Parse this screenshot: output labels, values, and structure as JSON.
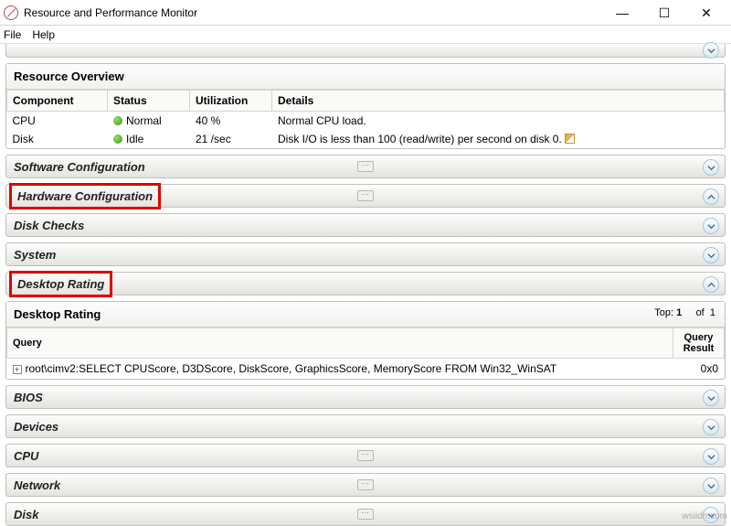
{
  "window": {
    "title": "Resource and Performance Monitor"
  },
  "menu": {
    "file": "File",
    "help": "Help"
  },
  "overview": {
    "title": "Resource Overview",
    "cols": {
      "component": "Component",
      "status": "Status",
      "util": "Utilization",
      "details": "Details"
    },
    "rows": [
      {
        "component": "CPU",
        "status": "Normal",
        "util": "40 %",
        "details": "Normal CPU load."
      },
      {
        "component": "Disk",
        "status": "Idle",
        "util": "21 /sec",
        "details": "Disk I/O is less than 100 (read/write) per second on disk 0.",
        "editable": true
      }
    ]
  },
  "sections": {
    "software": "Software Configuration",
    "hardware": "Hardware Configuration",
    "diskchecks": "Disk Checks",
    "system": "System",
    "desktoprating": "Desktop Rating",
    "bios": "BIOS",
    "devices": "Devices",
    "cpu": "CPU",
    "network": "Network",
    "disk": "Disk"
  },
  "desktop_rating": {
    "title": "Desktop Rating",
    "top_label": "Top:",
    "top_value": "1",
    "of_label": "of",
    "of_value": "1",
    "query_col": "Query",
    "result_col": "Query Result",
    "row": {
      "query": "root\\cimv2:SELECT CPUScore, D3DScore, DiskScore, GraphicsScore, MemoryScore FROM Win32_WinSAT",
      "result": "0x0"
    }
  },
  "watermark": "wsiidn.com"
}
